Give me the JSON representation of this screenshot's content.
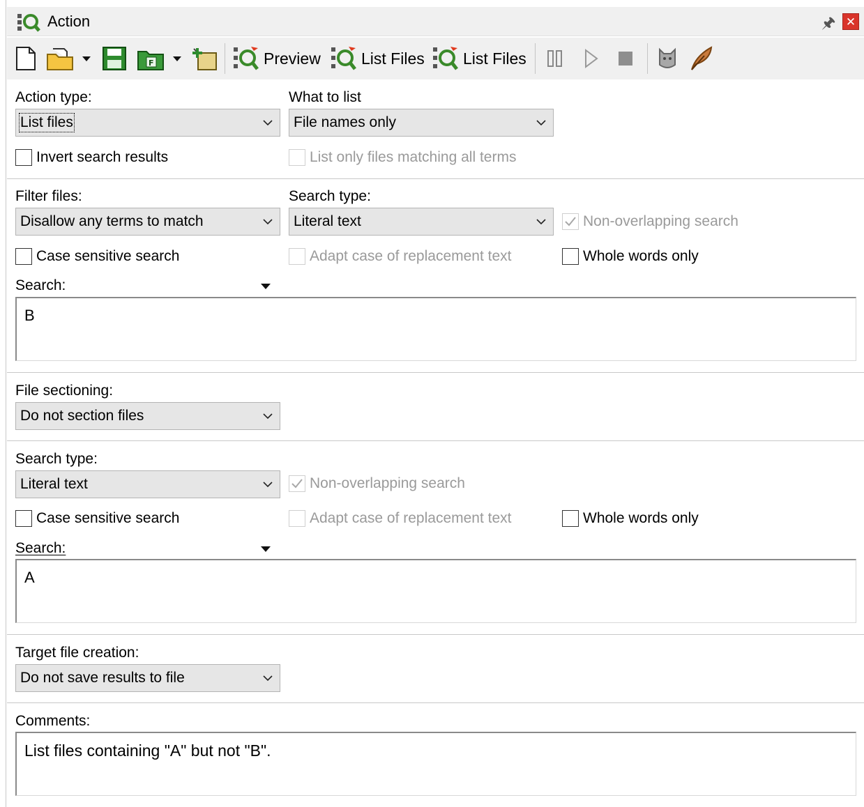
{
  "window": {
    "title": "Action"
  },
  "toolbar": {
    "preview_label": "Preview",
    "list_files_label_1": "List Files",
    "list_files_label_2": "List Files"
  },
  "action_section": {
    "action_type_label": "Action type:",
    "action_type_value": "List files",
    "what_to_list_label": "What to list",
    "what_to_list_value": "File names only",
    "invert_search_label": "Invert search results",
    "list_only_matching_label": "List only files matching all terms"
  },
  "filter_section": {
    "filter_files_label": "Filter files:",
    "filter_files_value": "Disallow any terms to match",
    "search_type_label": "Search type:",
    "search_type_value": "Literal text",
    "non_overlapping_label": "Non-overlapping search",
    "case_sensitive_label": "Case sensitive search",
    "adapt_case_label": "Adapt case of replacement text",
    "whole_words_label": "Whole words only",
    "search_label": "Search:",
    "search_value": "B"
  },
  "sectioning_section": {
    "label": "File sectioning:",
    "value": "Do not section files"
  },
  "search_section": {
    "search_type_label": "Search type:",
    "search_type_value": "Literal text",
    "non_overlapping_label": "Non-overlapping search",
    "case_sensitive_label": "Case sensitive search",
    "adapt_case_label": "Adapt case of replacement text",
    "whole_words_label": "Whole words only",
    "search_label": "Search:",
    "search_value": "A"
  },
  "target_section": {
    "label": "Target file creation:",
    "value": "Do not save results to file"
  },
  "comments_section": {
    "label": "Comments:",
    "value": "List files containing \"A\" but not \"B\"."
  }
}
